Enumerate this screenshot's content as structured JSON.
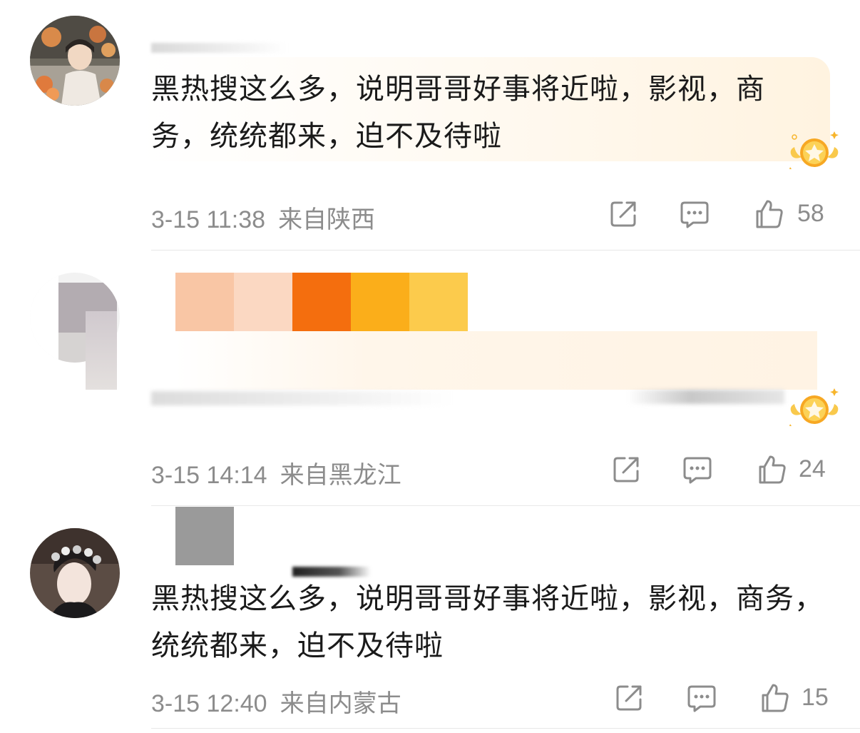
{
  "comments": [
    {
      "text": "黑热搜这么多，说明哥哥好事将近啦，影视，商务，统统都来，迫不及待啦",
      "time": "3-15 11:38",
      "location": "来自陕西",
      "likes": "58",
      "has_badge": true
    },
    {
      "text": "",
      "time": "3-15 14:14",
      "location": "来自黑龙江",
      "likes": "24",
      "has_badge": true
    },
    {
      "text": "黑热搜这么多，说明哥哥好事将近啦，影视，商务，统统都来，迫不及待啦",
      "time": "3-15 12:40",
      "location": "来自内蒙古",
      "likes": "15",
      "has_badge": false
    }
  ],
  "icons": {
    "share": "share-icon",
    "comment": "comment-icon",
    "like": "thumbs-up-icon",
    "badge": "star-badge-icon"
  },
  "colors": {
    "meta_text": "#8c8c8c",
    "divider": "#e8e8e8",
    "badge_gold": "#f7b52c",
    "bubble_tint": "#fff3e0"
  },
  "mosaic_colors": [
    "#f9c6a5",
    "#fbd8c2",
    "#f46e0e",
    "#fbae1a",
    "#fccb4c"
  ]
}
